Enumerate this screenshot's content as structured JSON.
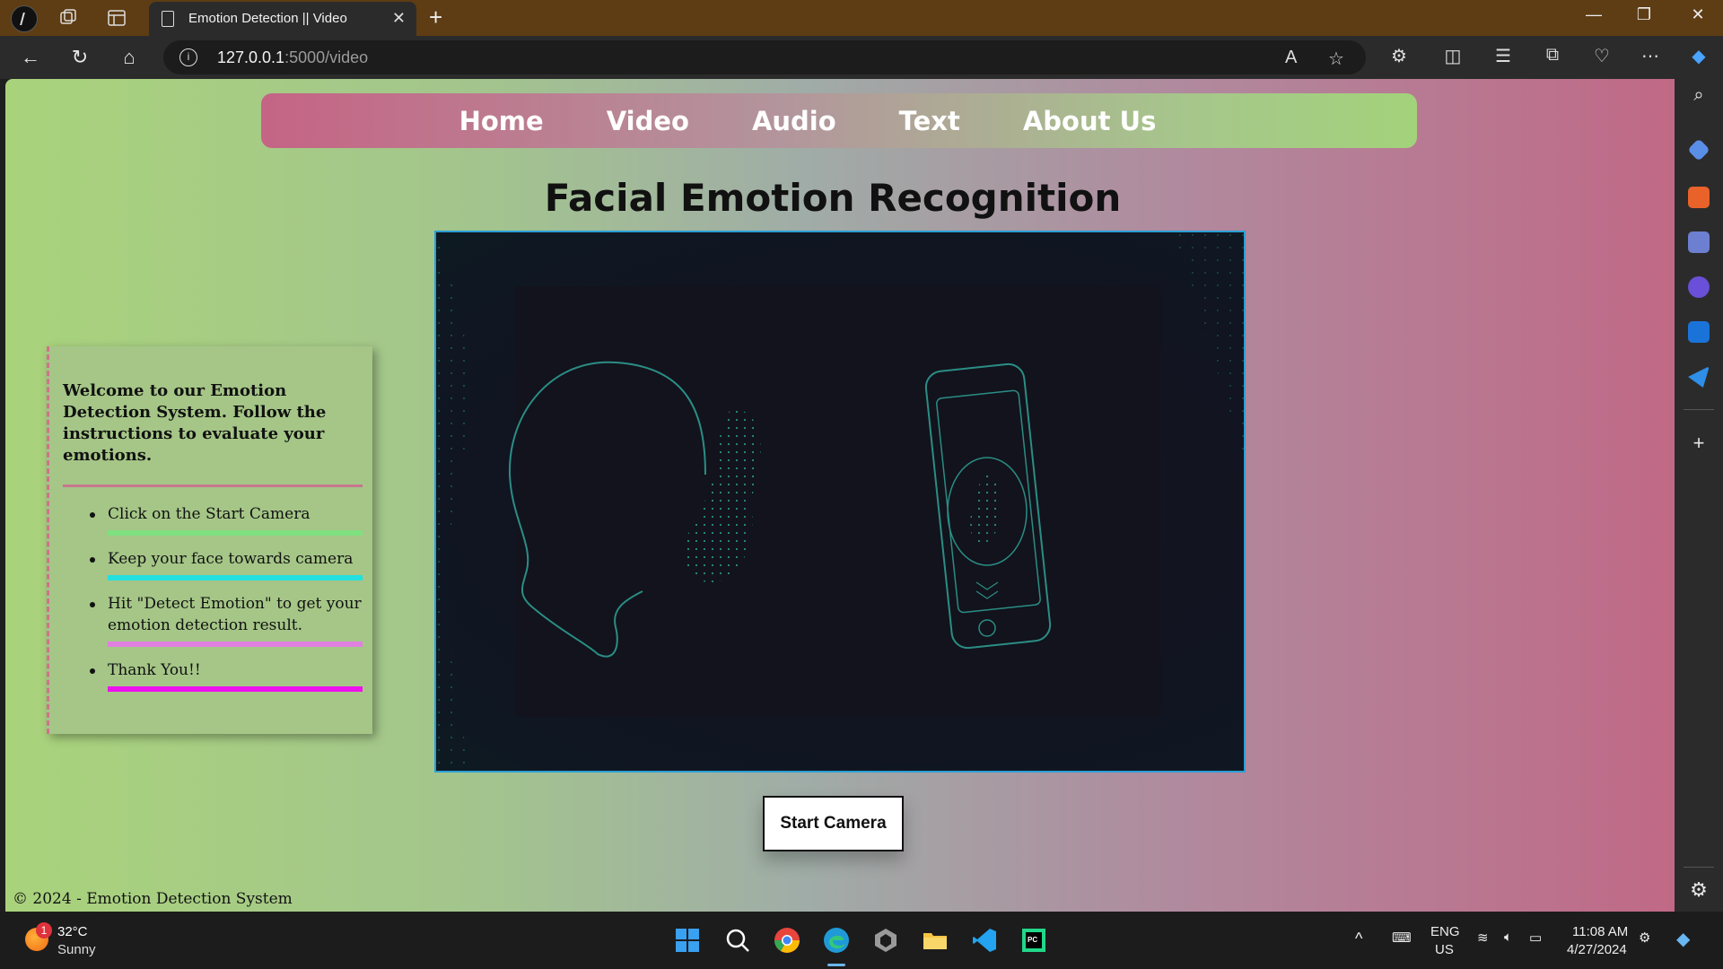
{
  "browser": {
    "tab_title": "Emotion Detection || Video",
    "url_host": "127.0.0.1",
    "url_rest": ":5000/video",
    "close_tab": "✕",
    "new_tab": "+"
  },
  "nav": {
    "items": [
      {
        "label": "Home"
      },
      {
        "label": "Video"
      },
      {
        "label": "Audio"
      },
      {
        "label": "Text"
      },
      {
        "label": "About Us"
      }
    ]
  },
  "page": {
    "title": "Facial Emotion Recognition",
    "start_button": "Start Camera",
    "footer": "© 2024 - Emotion Detection System"
  },
  "instructions": {
    "intro": "Welcome to our Emotion Detection System. Follow the instructions to evaluate your emotions.",
    "steps": [
      {
        "text": "Click on the Start Camera",
        "color": "#7fe07f"
      },
      {
        "text": "Keep your face towards camera",
        "color": "#22e0e0"
      },
      {
        "text": "Hit \"Detect Emotion\" to get your emotion detection result.",
        "color": "#e080e0"
      },
      {
        "text": "Thank You!!",
        "color": "#ee11ee"
      }
    ]
  },
  "taskbar": {
    "weather_temp": "32°C",
    "weather_desc": "Sunny",
    "weather_badge": "1",
    "lang_top": "ENG",
    "lang_bottom": "US",
    "time": "11:08 AM",
    "date": "4/27/2024"
  }
}
